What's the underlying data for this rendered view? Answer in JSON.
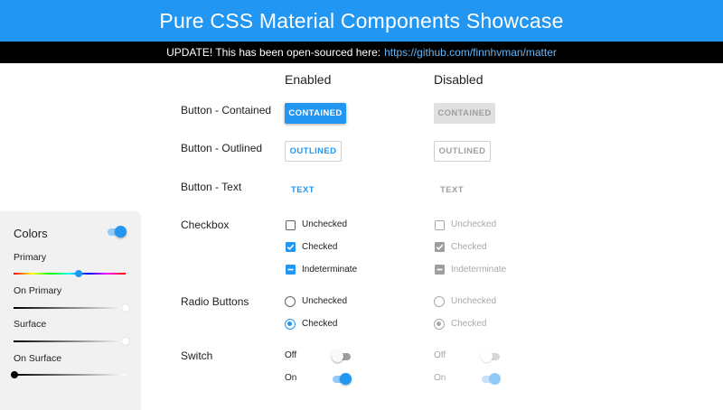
{
  "header": {
    "title": "Pure CSS Material Components Showcase"
  },
  "banner": {
    "text": "UPDATE! This has been open-sourced here:",
    "link": "https://github.com/finnhvman/matter"
  },
  "columns": {
    "enabled": "Enabled",
    "disabled": "Disabled"
  },
  "rows": {
    "contained": {
      "label": "Button - Contained",
      "button": "CONTAINED"
    },
    "outlined": {
      "label": "Button - Outlined",
      "button": "OUTLINED"
    },
    "text": {
      "label": "Button - Text",
      "button": "TEXT"
    },
    "checkbox": {
      "label": "Checkbox",
      "options": [
        "Unchecked",
        "Checked",
        "Indeterminate"
      ]
    },
    "radio": {
      "label": "Radio Buttons",
      "options": [
        "Unchecked",
        "Checked"
      ]
    },
    "switch": {
      "label": "Switch",
      "off": "Off",
      "on": "On"
    }
  },
  "colors_panel": {
    "title": "Colors",
    "toggle_on": true,
    "sliders": [
      {
        "label": "Primary",
        "value": 0.58,
        "type": "hue"
      },
      {
        "label": "On Primary",
        "value": 1.0,
        "type": "dark"
      },
      {
        "label": "Surface",
        "value": 1.0,
        "type": "dark"
      },
      {
        "label": "On Surface",
        "value": 0.0,
        "type": "dark"
      }
    ]
  },
  "accent_color": "#2196f3"
}
